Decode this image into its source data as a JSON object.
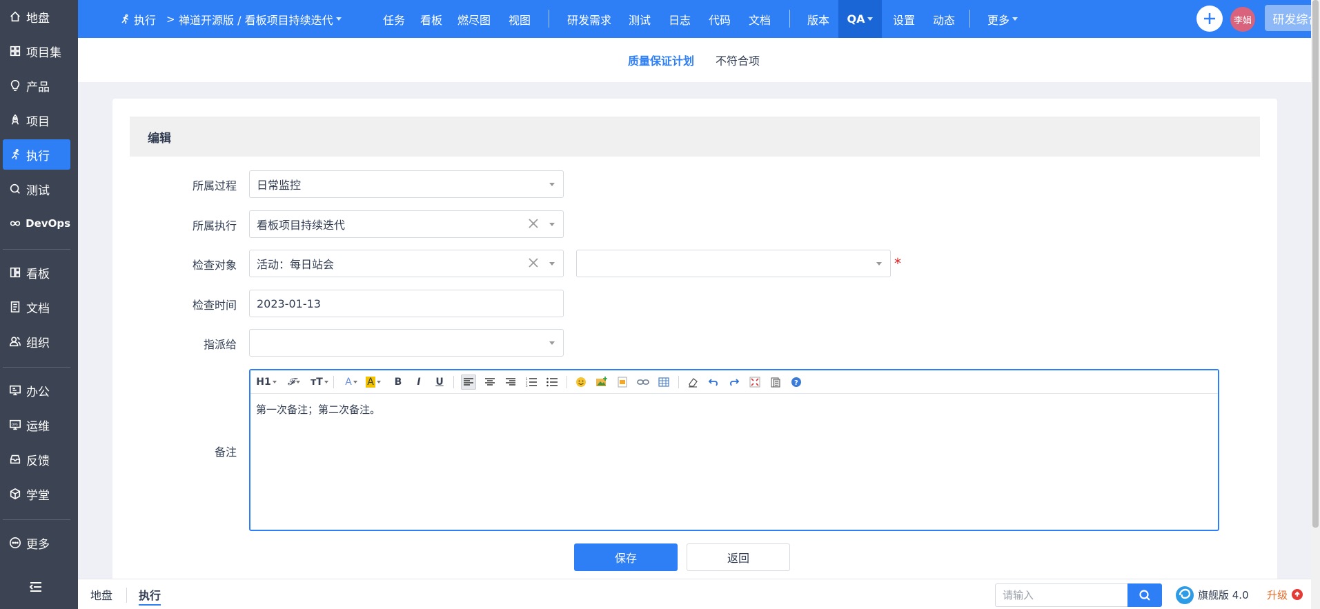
{
  "sidebar": {
    "items": [
      {
        "label": "地盘",
        "icon": "home-icon"
      },
      {
        "label": "项目集",
        "icon": "grid-icon"
      },
      {
        "label": "产品",
        "icon": "lightbulb-icon"
      },
      {
        "label": "项目",
        "icon": "rocket-icon"
      },
      {
        "label": "执行",
        "icon": "run-icon",
        "active": true
      },
      {
        "label": "测试",
        "icon": "search-icon"
      },
      {
        "label": "DevOps",
        "icon": "infinity-icon"
      },
      {
        "label": "看板",
        "icon": "kanban-icon"
      },
      {
        "label": "文档",
        "icon": "doc-icon"
      },
      {
        "label": "组织",
        "icon": "people-icon"
      },
      {
        "label": "办公",
        "icon": "office-icon"
      },
      {
        "label": "运维",
        "icon": "ops-icon"
      },
      {
        "label": "反馈",
        "icon": "feedback-icon"
      },
      {
        "label": "学堂",
        "icon": "cube-icon"
      },
      {
        "label": "更多",
        "icon": "more-icon"
      }
    ]
  },
  "topbar": {
    "module": "执行",
    "breadcrumb_sep": ">",
    "project": "禅道开源版 / 看板项目持续迭代",
    "nav": [
      "任务",
      "看板",
      "燃尽图",
      "视图",
      "研发需求",
      "测试",
      "日志",
      "代码",
      "文档",
      "版本",
      "QA",
      "设置",
      "动态",
      "更多"
    ],
    "active_nav": "QA",
    "user": "李娟",
    "switch_btn": "研发综合界面",
    "accent": "#2e7ff5"
  },
  "subnav": {
    "tabs": [
      "质量保证计划",
      "不符合项"
    ]
  },
  "form": {
    "title": "编辑",
    "process_label": "所属过程",
    "process_value": "日常监控",
    "execution_label": "所属执行",
    "execution_value": "看板项目持续迭代",
    "object_label": "检查对象",
    "object_value": "活动：每日站会",
    "object_sub_value": "",
    "required_mark": "*",
    "date_label": "检查时间",
    "date_value": "2023-01-13",
    "assign_label": "指派给",
    "assign_value": "",
    "note_label": "备注",
    "note_value": "第一次备注；第二次备注。"
  },
  "editor": {
    "heading": "H1",
    "font": "𝓕",
    "size": "тT",
    "color": "A",
    "bg": "A",
    "bold": "B",
    "italic": "I",
    "underline": "U"
  },
  "buttons": {
    "save": "保存",
    "back": "返回"
  },
  "bottombar": {
    "crumb_home": "地盘",
    "crumb_current": "执行",
    "search_placeholder": "请输入",
    "version": "旗舰版 4.0",
    "upgrade": "升级"
  }
}
